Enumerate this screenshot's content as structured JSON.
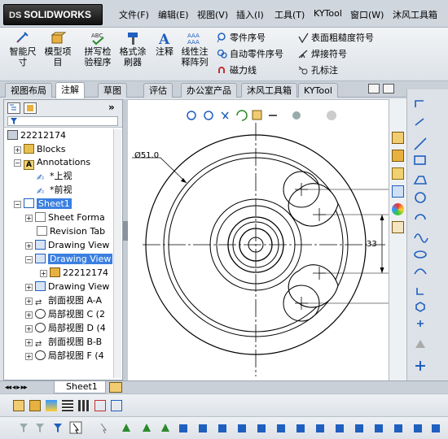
{
  "app": {
    "brand": "SOLIDWORKS",
    "brand_prefix": "DS"
  },
  "menu": [
    "文件(F)",
    "编辑(E)",
    "视图(V)",
    "插入(I)",
    "工具(T)",
    "KYTool",
    "窗口(W)",
    "沐风工具箱"
  ],
  "ribbon": {
    "big_buttons": [
      {
        "label": "智能尺寸",
        "icon": "smart-dimension-icon"
      },
      {
        "label": "模型项目",
        "icon": "model-items-icon"
      },
      {
        "label": "拼写检验程序",
        "icon": "spell-checker-icon"
      },
      {
        "label": "格式涂刷器",
        "icon": "format-painter-icon"
      },
      {
        "label": "注释",
        "icon": "note-icon"
      },
      {
        "label": "线性注释阵列",
        "icon": "linear-note-pattern-icon"
      }
    ],
    "col1": [
      "零件序号",
      "自动零件序号",
      "磁力线"
    ],
    "col2": [
      "表面粗糙度符号",
      "焊接符号",
      "孔标注"
    ]
  },
  "tabs": [
    "视图布局",
    "注解",
    "草图",
    "评估",
    "办公室产品",
    "沐风工具箱",
    "KYTool"
  ],
  "active_tab": "注解",
  "tree": {
    "root": "22212174",
    "items": [
      "Blocks",
      "Annotations",
      "*上视",
      "*前视",
      "Sheet1",
      "Sheet Forma",
      "Revision Tab",
      "Drawing View",
      "Drawing View",
      "22212174",
      "Drawing View",
      "剖面视图 A-A",
      "局部视图 C (2",
      "局部视图 D (4",
      "剖面视图 B-B",
      "局部视图 F (4"
    ]
  },
  "drawing": {
    "diameter_label": "Ø51.0",
    "dim_label": "33"
  },
  "sheet_tab": "Sheet1",
  "colors": {
    "accent": "#3a7fe0",
    "icon_blue": "#1f5fbf"
  }
}
